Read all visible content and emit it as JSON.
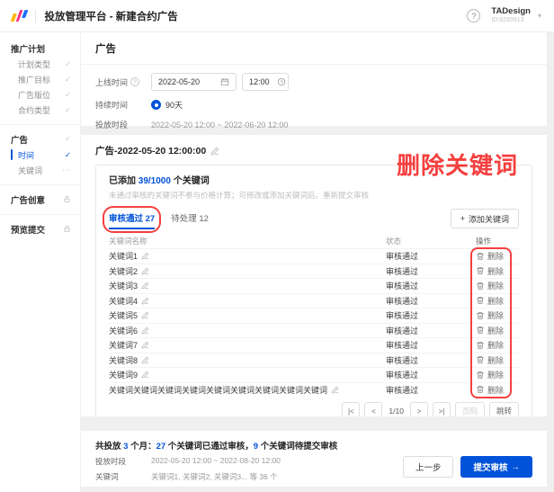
{
  "icons": {
    "check": "✓",
    "ellipsis": "⋯",
    "caret_down": "▾",
    "plus": "+",
    "arrow_right": "→"
  },
  "header": {
    "title": "投放管理平台 - 新建合约广告",
    "help_icon": "?",
    "user_name": "TADesign",
    "user_id": "ID:9285913"
  },
  "sidebar": {
    "sections": [
      {
        "title": "推广计划",
        "status": "",
        "items": [
          {
            "label": "计划类型",
            "status": "done"
          },
          {
            "label": "推广目标",
            "status": "done"
          },
          {
            "label": "广告版位",
            "status": "done"
          },
          {
            "label": "合约类型",
            "status": "done"
          }
        ]
      },
      {
        "title": "广告",
        "status": "done",
        "items": [
          {
            "label": "时间",
            "status": "active"
          },
          {
            "label": "关键词",
            "status": "pending"
          }
        ]
      },
      {
        "title": "广告创意",
        "status": "locked",
        "items": []
      },
      {
        "title": "预览提交",
        "status": "locked",
        "items": []
      }
    ]
  },
  "form": {
    "section_title": "广告",
    "online_time_label": "上线时间",
    "date_value": "2022-05-20",
    "time_value": "12:00",
    "duration_label": "持续时间",
    "duration_option": "90天",
    "period_label": "投放时段",
    "period_value": "2022-05-20 12:00 ~ 2022-06-20 12:00"
  },
  "keyword_section": {
    "title": "广告-2022-05-20 12:00:00",
    "added_prefix": "已添加",
    "added_count": "39/1000",
    "added_suffix": "个关键词",
    "hint": "未通过审核的关键词不参与价格计算；可修改或添加关键词后，重新提交审核",
    "tabs": [
      {
        "label": "审核通过",
        "count": "27",
        "active": true,
        "annotated": true
      },
      {
        "label": "待处理",
        "count": "12",
        "active": false,
        "annotated": false
      }
    ],
    "add_keyword_button": "添加关键词",
    "table": {
      "columns": [
        "关键词名称",
        "状态",
        "操作"
      ],
      "delete_label": "删除",
      "rows": [
        {
          "name": "关键词1",
          "status": "审核通过"
        },
        {
          "name": "关键词2",
          "status": "审核通过"
        },
        {
          "name": "关键词3",
          "status": "审核通过"
        },
        {
          "name": "关键词4",
          "status": "审核通过"
        },
        {
          "name": "关键词5",
          "status": "审核通过"
        },
        {
          "name": "关键词6",
          "status": "审核通过"
        },
        {
          "name": "关键词7",
          "status": "审核通过"
        },
        {
          "name": "关键词8",
          "status": "审核通过"
        },
        {
          "name": "关键词9",
          "status": "审核通过"
        },
        {
          "name": "关键词关键词关键词关键词关键词关键词关键词关键词关键词",
          "status": "审核通过"
        }
      ]
    },
    "pagination": {
      "first": "|<",
      "prev": "<",
      "current": "1/10",
      "next": ">",
      "last": ">|",
      "page_input": "页码",
      "jump": "跳转"
    }
  },
  "annotation": {
    "label": "删除关键词",
    "color": "#f53f3f"
  },
  "footer": {
    "summary": [
      {
        "text": "共投放 ",
        "hl": false
      },
      {
        "text": "3",
        "hl": true
      },
      {
        "text": " 个月：",
        "hl": false
      },
      {
        "text": "27",
        "hl": true
      },
      {
        "text": " 个关键词已通过审核，",
        "hl": false
      },
      {
        "text": "9",
        "hl": true
      },
      {
        "text": " 个关键词待提交审核",
        "hl": false
      }
    ],
    "period_label": "投放时段",
    "period_value": "2022-05-20 12:00 ~ 2022-08-20 12:00",
    "keywords_label": "关键词",
    "keywords_value": "关键词1, 关键词2, 关键词3... 等 36 个",
    "prev_button": "上一步",
    "submit_button": "提交审核"
  }
}
